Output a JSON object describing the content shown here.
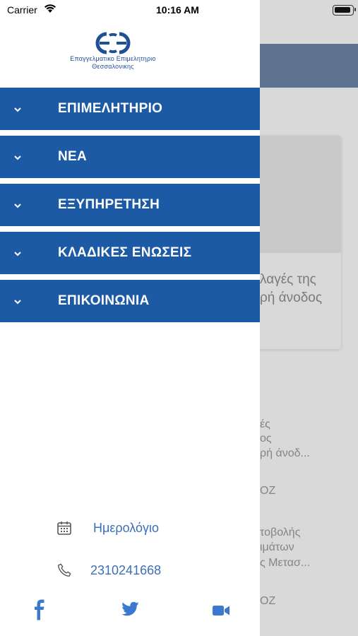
{
  "status_bar": {
    "carrier": "Carrier",
    "time": "10:16 AM"
  },
  "logo": {
    "line1": "Επαγγελματικο Επιμελητηριο",
    "line2": "Θεσσαλονικης"
  },
  "menu": [
    {
      "label": "ΕΠΙΜΕΛΗΤΗΡΙΟ"
    },
    {
      "label": "ΝΕΑ"
    },
    {
      "label": "ΕΞΥΠΗΡΕΤΗΣΗ"
    },
    {
      "label": "ΚΛΑΔΙΚΕΣ ΕΝΩΣΕΙΣ"
    },
    {
      "label": "ΕΠΙΚΟΙΝΩΝΙΑ"
    }
  ],
  "calendar": {
    "label": "Ημερολόγιο",
    "icon": "calendar-icon"
  },
  "phone": {
    "label": "2310241668",
    "icon": "phone-icon"
  },
  "social": {
    "facebook": "facebook-icon",
    "twitter": "twitter-icon",
    "video": "video-icon",
    "color": "#3b78d0"
  },
  "background": {
    "card_line1": "λαγές της",
    "card_line2": "ρή άνοδος",
    "item1_line1": "ές",
    "item1_line2": "ος",
    "item1_line3": "ρή άνοδ...",
    "item1_meta": "ΟΖ",
    "item2_line1": "τοβολής",
    "item2_line2": "ιμάτων",
    "item2_line3": "ς Μετασ...",
    "item2_meta": "ΟΖ"
  },
  "colors": {
    "menu_bg": "#1d5aa5",
    "link": "#3b6fb8",
    "header_dim": "#5e7390"
  }
}
